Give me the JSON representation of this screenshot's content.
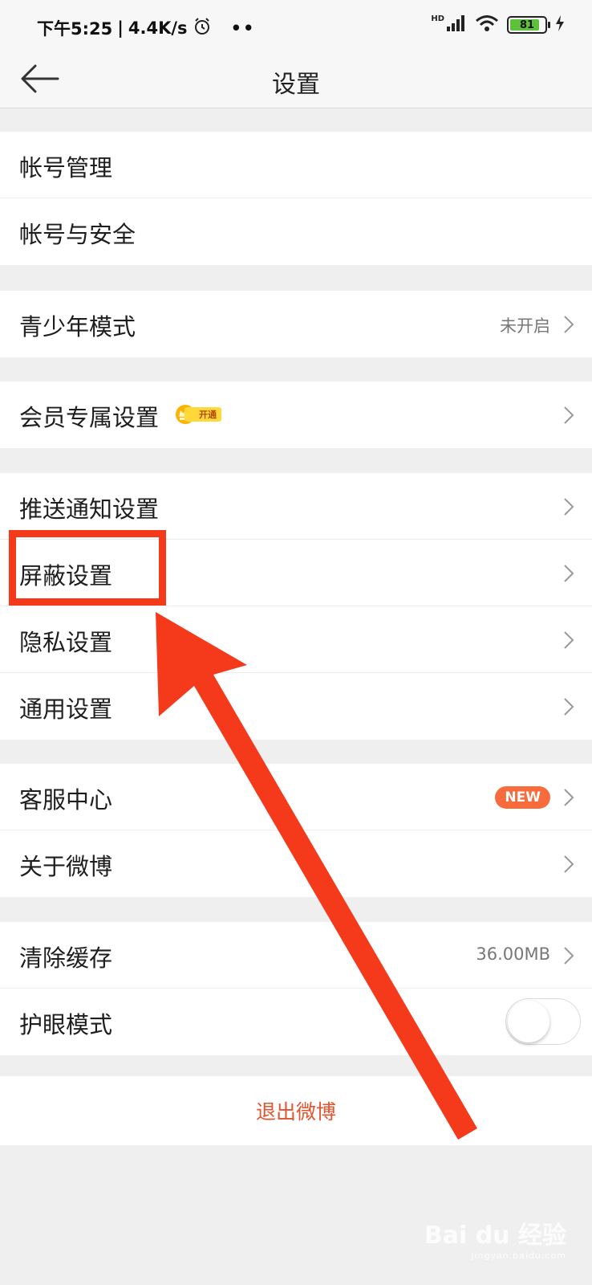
{
  "status_bar": {
    "time": "下午5:25",
    "speed": "4.4K/s",
    "battery": "81",
    "network": "HD"
  },
  "nav": {
    "title": "设置"
  },
  "groups": [
    {
      "items": [
        {
          "label": "帐号管理"
        },
        {
          "label": "帐号与安全"
        }
      ]
    },
    {
      "items": [
        {
          "label": "青少年模式",
          "value": "未开启"
        }
      ]
    },
    {
      "items": [
        {
          "label": "会员专属设置",
          "badge": "开通"
        }
      ]
    },
    {
      "items": [
        {
          "label": "推送通知设置"
        },
        {
          "label": "屏蔽设置"
        },
        {
          "label": "隐私设置"
        },
        {
          "label": "通用设置"
        }
      ]
    },
    {
      "items": [
        {
          "label": "客服中心",
          "badge": "NEW"
        },
        {
          "label": "关于微博"
        }
      ]
    },
    {
      "items": [
        {
          "label": "清除缓存",
          "value": "36.00MB"
        },
        {
          "label": "护眼模式",
          "toggle": false
        }
      ]
    }
  ],
  "logout_label": "退出微博",
  "watermark": {
    "brand": "Bai du 经验",
    "url": "jingyan.baidu.com"
  },
  "colors": {
    "accent": "#f53a1c",
    "logout": "#e05530",
    "new_badge": "#f86b3c"
  }
}
